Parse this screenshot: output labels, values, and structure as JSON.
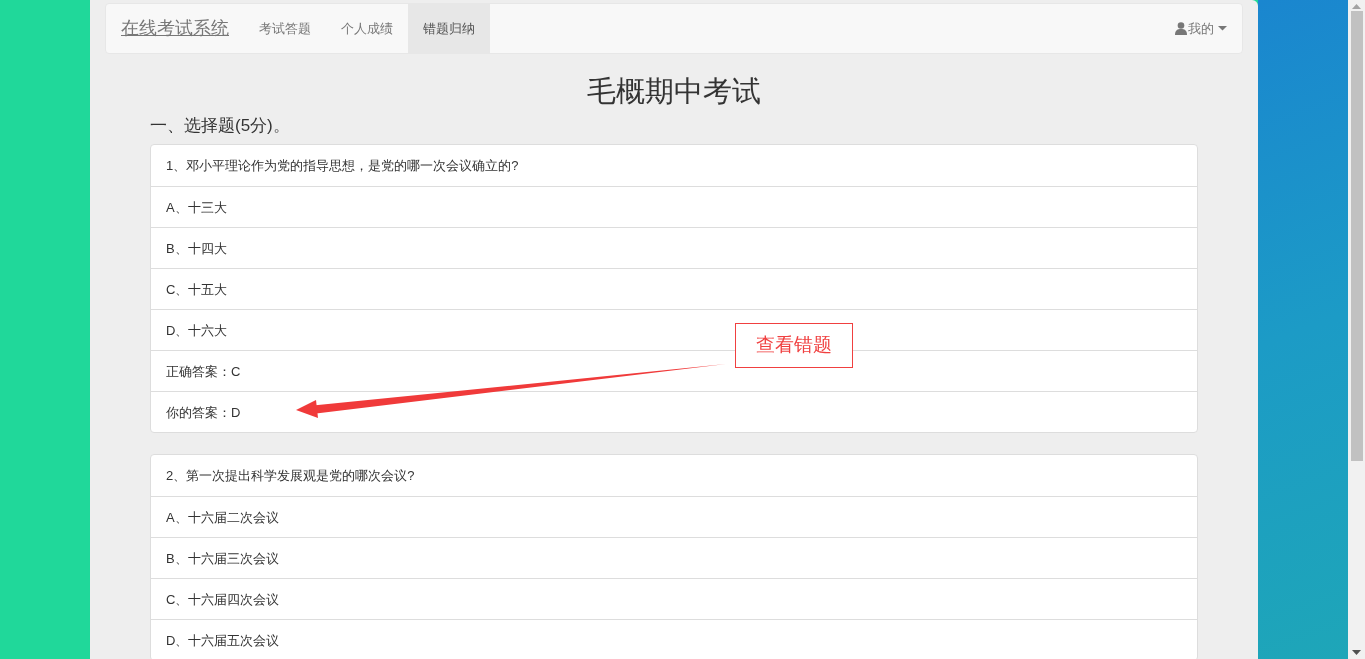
{
  "navbar": {
    "brand": "在线考试系统",
    "items": [
      {
        "label": "考试答题",
        "selected": false
      },
      {
        "label": "个人成绩",
        "selected": false
      },
      {
        "label": "错题归纳",
        "selected": true
      }
    ],
    "user_menu": "我的"
  },
  "title": "毛概期中考试",
  "section": "一、选择题(5分)。",
  "questions": [
    {
      "question": "1、邓小平理论作为党的指导思想，是党的哪一次会议确立的?",
      "options": [
        "A、十三大",
        "B、十四大",
        "C、十五大",
        "D、十六大"
      ],
      "correct_answer": "正确答案：C",
      "your_answer": "你的答案：D"
    },
    {
      "question": "2、第一次提出科学发展观是党的哪次会议?",
      "options": [
        "A、十六届二次会议",
        "B、十六届三次会议",
        "C、十六届四次会议",
        "D、十六届五次会议"
      ]
    }
  ],
  "annotation": {
    "text": "查看错题"
  }
}
